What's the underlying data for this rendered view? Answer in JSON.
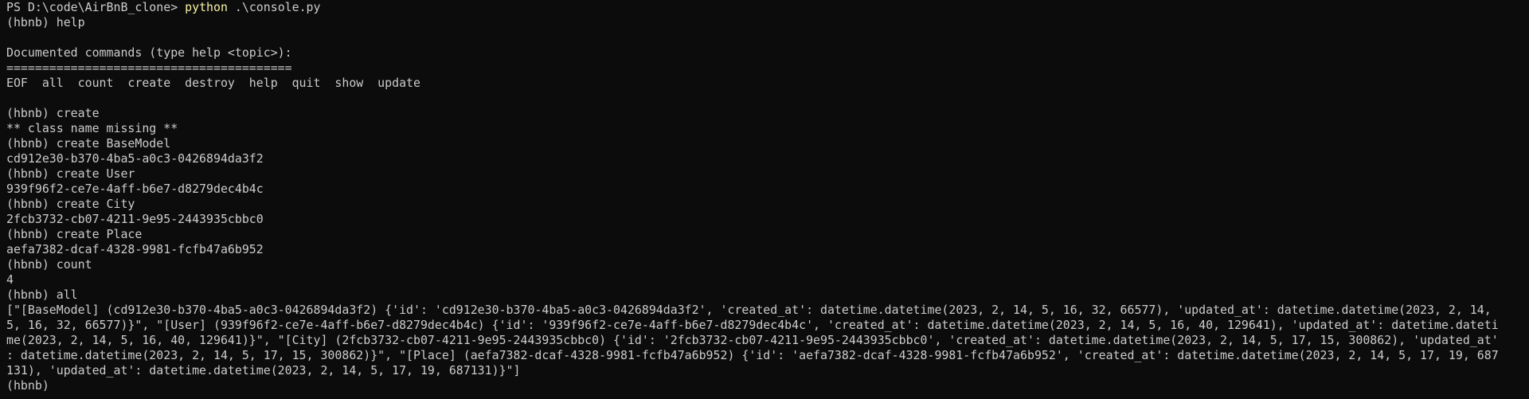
{
  "terminal": {
    "first_prompt": "PS D:\\code\\AirBnB_clone>",
    "first_cmd": "python",
    "first_args": ".\\console.py",
    "lines": [
      "(hbnb) help",
      "",
      "Documented commands (type help <topic>):",
      "========================================",
      "EOF  all  count  create  destroy  help  quit  show  update",
      "",
      "(hbnb) create",
      "** class name missing **",
      "(hbnb) create BaseModel",
      "cd912e30-b370-4ba5-a0c3-0426894da3f2",
      "(hbnb) create User",
      "939f96f2-ce7e-4aff-b6e7-d8279dec4b4c",
      "(hbnb) create City",
      "2fcb3732-cb07-4211-9e95-2443935cbbc0",
      "(hbnb) create Place",
      "aefa7382-dcaf-4328-9981-fcfb47a6b952",
      "(hbnb) count",
      "4",
      "(hbnb) all",
      "[\"[BaseModel] (cd912e30-b370-4ba5-a0c3-0426894da3f2) {'id': 'cd912e30-b370-4ba5-a0c3-0426894da3f2', 'created_at': datetime.datetime(2023, 2, 14, 5, 16, 32, 66577), 'updated_at': datetime.datetime(2023, 2, 14,",
      "5, 16, 32, 66577)}\", \"[User] (939f96f2-ce7e-4aff-b6e7-d8279dec4b4c) {'id': '939f96f2-ce7e-4aff-b6e7-d8279dec4b4c', 'created_at': datetime.datetime(2023, 2, 14, 5, 16, 40, 129641), 'updated_at': datetime.dateti",
      "me(2023, 2, 14, 5, 16, 40, 129641)}\", \"[City] (2fcb3732-cb07-4211-9e95-2443935cbbc0) {'id': '2fcb3732-cb07-4211-9e95-2443935cbbc0', 'created_at': datetime.datetime(2023, 2, 14, 5, 17, 15, 300862), 'updated_at'",
      ": datetime.datetime(2023, 2, 14, 5, 17, 15, 300862)}\", \"[Place] (aefa7382-dcaf-4328-9981-fcfb47a6b952) {'id': 'aefa7382-dcaf-4328-9981-fcfb47a6b952', 'created_at': datetime.datetime(2023, 2, 14, 5, 17, 19, 687",
      "131), 'updated_at': datetime.datetime(2023, 2, 14, 5, 17, 19, 687131)}\"]",
      "(hbnb)"
    ],
    "colors": {
      "background": "#0c0c0c",
      "foreground": "#cccccc",
      "command_highlight": "#f9f1a5"
    }
  }
}
